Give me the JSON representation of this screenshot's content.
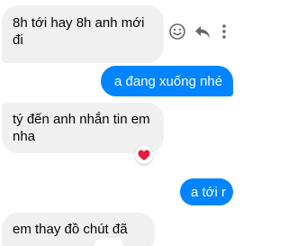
{
  "messages": [
    {
      "direction": "incoming",
      "text": "8h tới hay 8h anh mới đi"
    },
    {
      "direction": "outgoing",
      "text": "a đang xuống nhé"
    },
    {
      "direction": "incoming",
      "text": "tý đến anh nhắn tin em nha",
      "reaction": "heart"
    },
    {
      "direction": "outgoing",
      "text": "a tới r"
    },
    {
      "direction": "incoming",
      "text": "em thay đồ chút đã"
    }
  ],
  "hover_actions": {
    "icons": [
      "smiley-icon",
      "reply-icon",
      "more-vertical-icon"
    ]
  },
  "colors": {
    "outgoing_bubble": "#0084ff",
    "incoming_bubble": "#f0f0f0",
    "heart": "#e41e3f",
    "icon_gray": "#65676b"
  }
}
